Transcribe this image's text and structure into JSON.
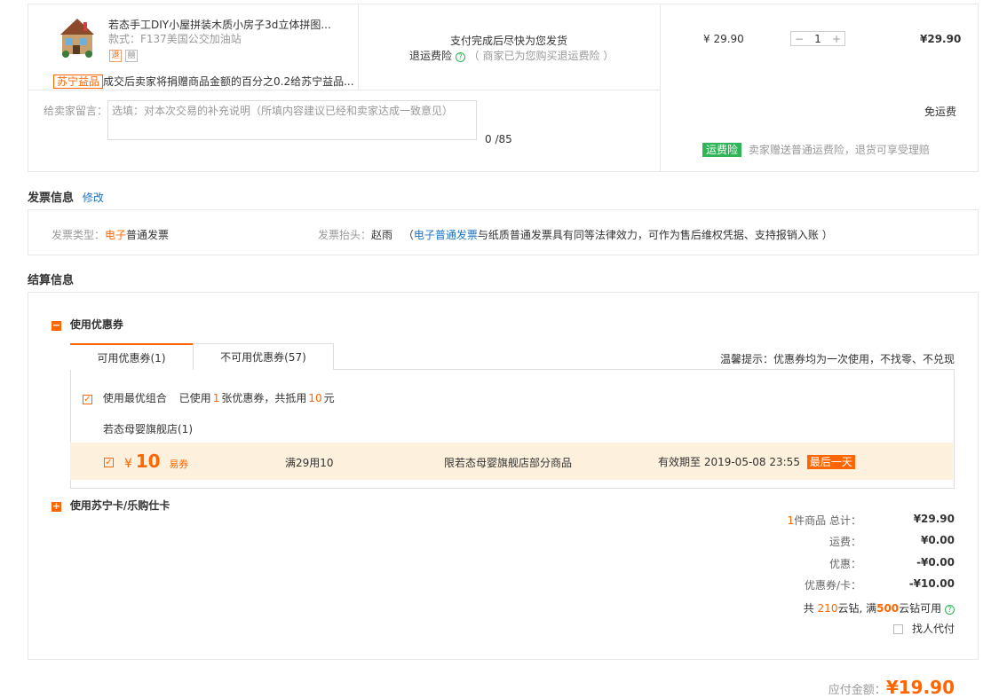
{
  "product": {
    "title": "若态手工DIY小屋拼装木质小房子3d立体拼图...",
    "spec": "款式：F137美国公交加油站",
    "tags": [
      "退",
      "囍"
    ],
    "charity_badge": "苏宁益品",
    "charity_text": "成交后卖家将捐赠商品金额的百分之0.2给苏宁益品...",
    "ship_note": "支付完成后尽快为您发货",
    "return_insurance_label": "退运费险",
    "return_insurance_note": "（ 商家已为您购买退运费险 ）",
    "unit_price": "¥ 29.90",
    "quantity": "1",
    "subtotal": "¥29.90"
  },
  "message": {
    "label": "给卖家留言：",
    "placeholder": "选填：对本次交易的补充说明（所填内容建议已经和卖家达成一致意见）",
    "counter": "0 /85",
    "shipping_free": "免运费",
    "insurance_badge": "运费险",
    "insurance_text": "卖家赠送普通运费险，退货可享受理赔"
  },
  "invoice": {
    "section_title": "发票信息",
    "edit_link": "修改",
    "type_label": "发票类型：",
    "type_highlight": "电子",
    "type_value": "普通发票",
    "header_label": "发票抬头：",
    "header_value": "赵雨",
    "note_open": "（",
    "note_link": "电子普通发票",
    "note_text": "与纸质普通发票具有同等法律效力，可作为售后维权凭据、支持报销入账 ）"
  },
  "settlement": {
    "section_title": "结算信息",
    "coupon_section": "使用优惠券",
    "tab_available": "可用优惠券(1)",
    "tab_unavailable": "不可用优惠券(57)",
    "tip": "温馨提示：优惠券均为一次使用，不找零、不兑现",
    "best_combo": "使用最优组合",
    "used_prefix": "已使用",
    "used_count": "1",
    "used_mid": "张优惠券，共抵用",
    "used_amount": "10",
    "used_suffix": "元",
    "store": "若态母婴旗舰店(1)",
    "coupon": {
      "currency": "¥",
      "amount": "10",
      "type": "易券",
      "condition": "满29用10",
      "scope": "限若态母婴旗舰店部分商品",
      "expiry": "有效期至 2019-05-08 23:55",
      "last_day": "最后一天"
    },
    "card_section": "使用苏宁卡/乐购仕卡"
  },
  "summary": {
    "count": "1",
    "count_label": "件商品 总计：",
    "total": "¥29.90",
    "freight_label": "运费：",
    "freight": "¥0.00",
    "discount_label": "优惠：",
    "discount": "-¥0.00",
    "coupon_label": "优惠券/卡：",
    "coupon": "-¥10.00",
    "cloud_prefix": "共",
    "cloud_count": "210",
    "cloud_mid": "云钻, 满",
    "cloud_min": "500",
    "cloud_suffix": "云钻可用",
    "find_pay": "找人代付",
    "payable_label": "应付金额：",
    "payable": "¥19.90"
  }
}
